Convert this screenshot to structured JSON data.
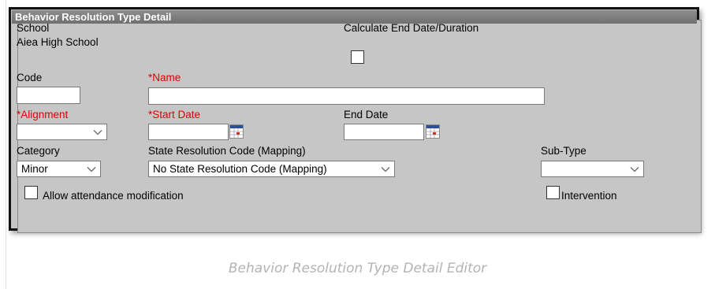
{
  "panel": {
    "title": "Behavior Resolution Type Detail"
  },
  "fields": {
    "school_label": "School",
    "school_value": "Aiea High School",
    "calc_end_label": "Calculate End Date/Duration",
    "code_label": "Code",
    "code_value": "",
    "name_label": "*Name",
    "name_value": "",
    "alignment_label": "*Alignment",
    "alignment_value": "",
    "start_date_label": "*Start Date",
    "start_date_value": "",
    "end_date_label": "End Date",
    "end_date_value": "",
    "category_label": "Category",
    "category_value": "Minor",
    "state_code_label": "State Resolution Code (Mapping)",
    "state_code_value": "No State Resolution Code (Mapping)",
    "subtype_label": "Sub-Type",
    "subtype_value": "",
    "allow_attendance_label": "Allow attendance modification",
    "intervention_label": "Intervention"
  },
  "checkboxes": {
    "calculate_end_date": false,
    "allow_attendance_modification": false,
    "intervention": false
  },
  "icons": {
    "calendar": "calendar-icon",
    "dropdown": "chevron-down-icon"
  },
  "colors": {
    "required_label": "#e00000",
    "header_bg": "#7d7d7d",
    "panel_bg": "#c6c6c6"
  },
  "caption": "Behavior Resolution Type Detail Editor"
}
